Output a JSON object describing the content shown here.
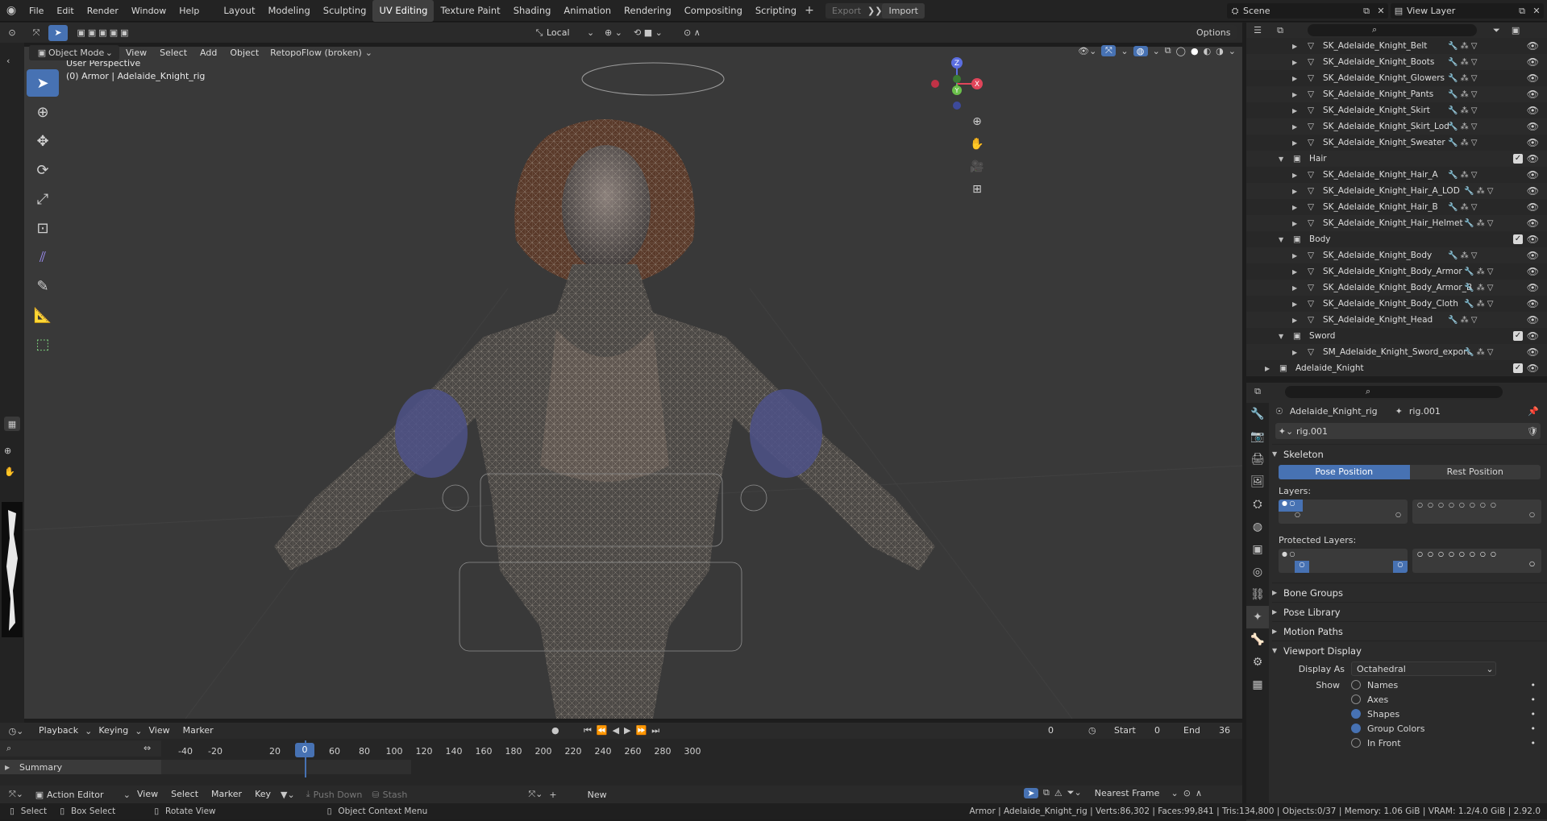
{
  "menus": [
    "File",
    "Edit",
    "Render",
    "Window",
    "Help"
  ],
  "workspaces": [
    "Layout",
    "Modeling",
    "Sculpting",
    "UV Editing",
    "Texture Paint",
    "Shading",
    "Animation",
    "Rendering",
    "Compositing",
    "Scripting"
  ],
  "active_workspace": "UV Editing",
  "top_buttons": {
    "export": "Export",
    "import": "Import"
  },
  "scene": {
    "scene_label": "Scene",
    "view_layer": "View Layer"
  },
  "vp_header": {
    "transform_orientation": "Local",
    "options": "Options",
    "mode": "Object Mode",
    "menus": [
      "View",
      "Select",
      "Add",
      "Object"
    ],
    "addon": "RetopoFlow (broken)"
  },
  "viewport": {
    "perspective": "User Perspective",
    "object_info": "(0) Armor | Adelaide_Knight_rig"
  },
  "gizmo": {
    "x": "X",
    "y": "Y",
    "z": "Z"
  },
  "outliner": {
    "rows": [
      {
        "label": "SK_Adelaide_Knight_Belt",
        "indent": 3,
        "type": "mesh"
      },
      {
        "label": "SK_Adelaide_Knight_Boots",
        "indent": 3,
        "type": "mesh"
      },
      {
        "label": "SK_Adelaide_Knight_Glowers",
        "indent": 3,
        "type": "mesh"
      },
      {
        "label": "SK_Adelaide_Knight_Pants",
        "indent": 3,
        "type": "mesh"
      },
      {
        "label": "SK_Adelaide_Knight_Skirt",
        "indent": 3,
        "type": "mesh"
      },
      {
        "label": "SK_Adelaide_Knight_Skirt_Lod",
        "indent": 3,
        "type": "mesh"
      },
      {
        "label": "SK_Adelaide_Knight_Sweater",
        "indent": 3,
        "type": "mesh"
      },
      {
        "label": "Hair",
        "indent": 2,
        "type": "collection"
      },
      {
        "label": "SK_Adelaide_Knight_Hair_A",
        "indent": 3,
        "type": "mesh"
      },
      {
        "label": "SK_Adelaide_Knight_Hair_A_LOD",
        "indent": 3,
        "type": "mesh"
      },
      {
        "label": "SK_Adelaide_Knight_Hair_B",
        "indent": 3,
        "type": "mesh"
      },
      {
        "label": "SK_Adelaide_Knight_Hair_Helmet",
        "indent": 3,
        "type": "mesh"
      },
      {
        "label": "Body",
        "indent": 2,
        "type": "collection"
      },
      {
        "label": "SK_Adelaide_Knight_Body",
        "indent": 3,
        "type": "mesh"
      },
      {
        "label": "SK_Adelaide_Knight_Body_Armor",
        "indent": 3,
        "type": "mesh"
      },
      {
        "label": "SK_Adelaide_Knight_Body_Armor_B",
        "indent": 3,
        "type": "mesh"
      },
      {
        "label": "SK_Adelaide_Knight_Body_Cloth",
        "indent": 3,
        "type": "mesh"
      },
      {
        "label": "SK_Adelaide_Knight_Head",
        "indent": 3,
        "type": "mesh"
      },
      {
        "label": "Sword",
        "indent": 2,
        "type": "collection"
      },
      {
        "label": "SM_Adelaide_Knight_Sword_export",
        "indent": 3,
        "type": "mesh"
      },
      {
        "label": "Adelaide_Knight",
        "indent": 1,
        "type": "collection"
      }
    ]
  },
  "props": {
    "breadcrumb_obj": "Adelaide_Knight_rig",
    "breadcrumb_data": "rig.001",
    "datablock": "rig.001",
    "skeleton": "Skeleton",
    "pose_position": "Pose Position",
    "rest_position": "Rest Position",
    "layers": "Layers:",
    "protected_layers": "Protected Layers:",
    "panels": [
      "Bone Groups",
      "Pose Library",
      "Motion Paths"
    ],
    "viewport_display": "Viewport Display",
    "display_as_label": "Display As",
    "display_as_value": "Octahedral",
    "show_label": "Show",
    "show_items": [
      {
        "label": "Names",
        "on": false
      },
      {
        "label": "Axes",
        "on": false
      },
      {
        "label": "Shapes",
        "on": true
      },
      {
        "label": "Group Colors",
        "on": true
      },
      {
        "label": "In Front",
        "on": false
      }
    ]
  },
  "timeline": {
    "menus": [
      "Playback",
      "Keying",
      "View",
      "Marker"
    ],
    "current_frame": "0",
    "start_label": "Start",
    "start": "0",
    "end_label": "End",
    "end": "36",
    "ticks": [
      "-40",
      "-20",
      "0",
      "20",
      "40",
      "60",
      "80",
      "100",
      "120",
      "140",
      "160",
      "180",
      "200",
      "220",
      "240",
      "260",
      "280",
      "300"
    ],
    "summary": "Summary"
  },
  "action_editor": {
    "mode": "Action Editor",
    "menus": [
      "View",
      "Select",
      "Marker",
      "Key"
    ],
    "push_down": "Push Down",
    "stash": "Stash",
    "new": "New",
    "snap": "Nearest Frame"
  },
  "status": {
    "select": "Select",
    "box_select": "Box Select",
    "rotate_view": "Rotate View",
    "context_menu": "Object Context Menu",
    "stats": "Armor | Adelaide_Knight_rig | Verts:86,302 | Faces:99,841 | Tris:134,800 | Objects:0/37 | Memory: 1.06 GiB | VRAM: 1.2/4.0 GiB | 2.92.0"
  },
  "colors": {
    "accent": "#4772b3",
    "viewport_bg": "#393939",
    "header_bg": "#232323"
  }
}
